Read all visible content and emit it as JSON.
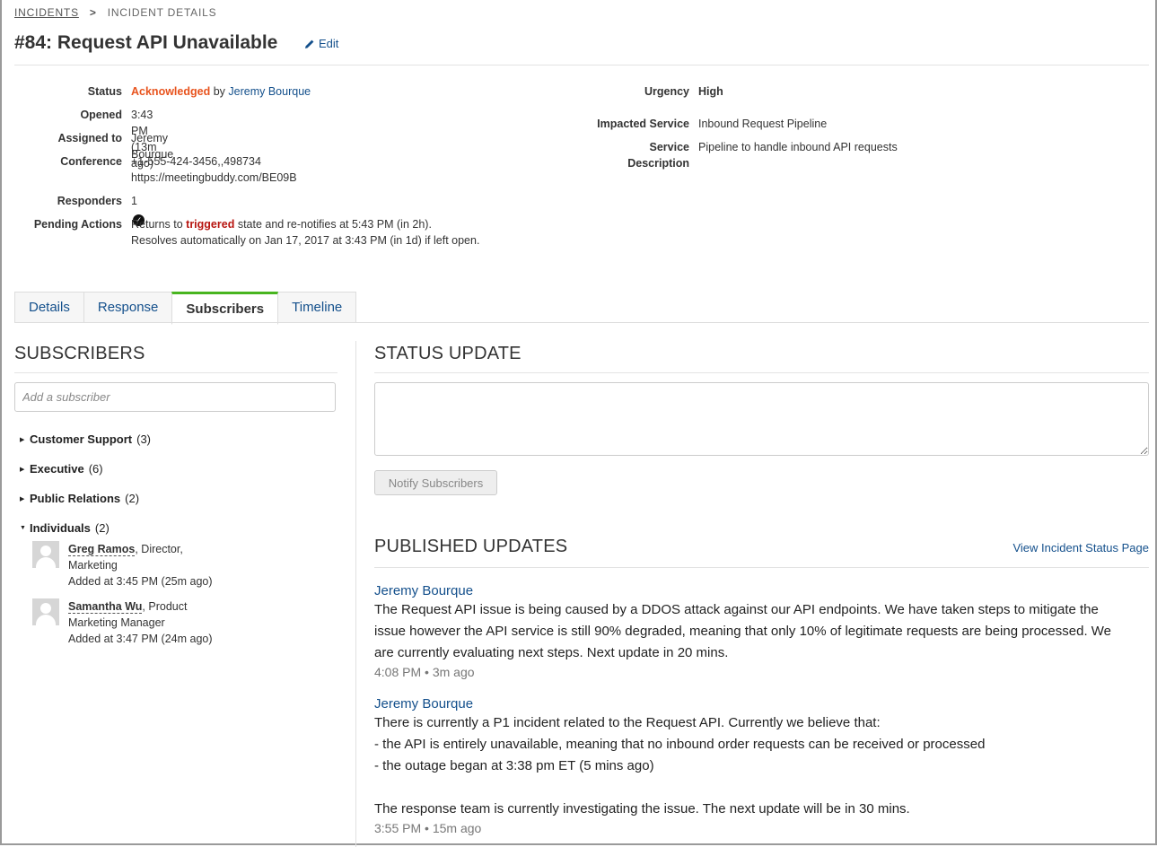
{
  "breadcrumb": {
    "root": "INCIDENTS",
    "current": "INCIDENT DETAILS"
  },
  "incident": {
    "title": "#84: Request API Unavailable",
    "edit_label": "Edit"
  },
  "details_left": {
    "status_label": "Status",
    "status_value": "Acknowledged",
    "status_by": "by",
    "status_user": "Jeremy Bourque",
    "opened_label": "Opened",
    "opened_value": "3:43 PM (13m ago)",
    "assigned_label": "Assigned to",
    "assigned_value": "Jeremy Bourque",
    "conference_label": "Conference",
    "conference_phone": "+1-555-424-3456,,498734",
    "conference_url": "https://meetingbuddy.com/BE09B",
    "responders_label": "Responders",
    "responders_value": "1",
    "pending_label": "Pending Actions",
    "pending_line1_a": "Returns to",
    "pending_line1_b": "triggered",
    "pending_line1_c": "state and re-notifies at 5:43 PM (in 2h).",
    "pending_line2": "Resolves automatically on Jan 17, 2017 at 3:43 PM (in 1d) if left open."
  },
  "details_right": {
    "urgency_label": "Urgency",
    "urgency_value": "High",
    "service_label": "Impacted Service",
    "service_value": "Inbound Request Pipeline",
    "desc_label_1": "Service",
    "desc_label_2": "Description",
    "desc_value": "Pipeline to handle inbound API requests"
  },
  "tabs": [
    {
      "label": "Details"
    },
    {
      "label": "Response"
    },
    {
      "label": "Subscribers"
    },
    {
      "label": "Timeline"
    }
  ],
  "active_tab": "Subscribers",
  "subscribers": {
    "heading": "SUBSCRIBERS",
    "add_placeholder": "Add a subscriber",
    "groups": [
      {
        "name": "Customer Support",
        "count": "(3)",
        "expanded": false
      },
      {
        "name": "Executive",
        "count": "(6)",
        "expanded": false
      },
      {
        "name": "Public Relations",
        "count": "(2)",
        "expanded": false
      },
      {
        "name": "Individuals",
        "count": "(2)",
        "expanded": true
      }
    ],
    "individuals": [
      {
        "name": "Greg Ramos",
        "role_a": ", Director,",
        "role_b": "Marketing",
        "added": "Added at 3:45 PM (25m ago)"
      },
      {
        "name": "Samantha Wu",
        "role_a": ", Product",
        "role_b": "Marketing Manager",
        "added": "Added at 3:47 PM (24m ago)"
      }
    ]
  },
  "status_update": {
    "heading": "STATUS UPDATE",
    "textarea_value": "",
    "notify_label": "Notify Subscribers"
  },
  "published": {
    "heading": "PUBLISHED UPDATES",
    "view_link": "View Incident Status Page",
    "updates": [
      {
        "author": "Jeremy Bourque",
        "lines": [
          "The Request API issue is being caused by a DDOS attack against our API endpoints. We have taken steps to mitigate the",
          "issue however the API service is still 90% degraded, meaning that only 10% of legitimate requests are being processed. We",
          "are currently evaluating next steps. Next update in 20 mins."
        ],
        "time": "4:08 PM",
        "ago": "3m ago"
      },
      {
        "author": "Jeremy Bourque",
        "lines": [
          "There is currently a P1 incident related to the Request API. Currently we believe that:",
          "- the API is entirely unavailable, meaning that no inbound order requests can be received or processed",
          "- the outage began at 3:38 pm ET (5 mins ago)",
          "",
          "The response team is currently investigating the issue. The next update will be in 30 mins."
        ],
        "time": "3:55 PM",
        "ago": "15m ago"
      }
    ]
  },
  "colors": {
    "link": "#14508c",
    "acknowledged": "#e8531d",
    "triggered": "#b7140f",
    "active_tab_accent": "#48b51f"
  }
}
